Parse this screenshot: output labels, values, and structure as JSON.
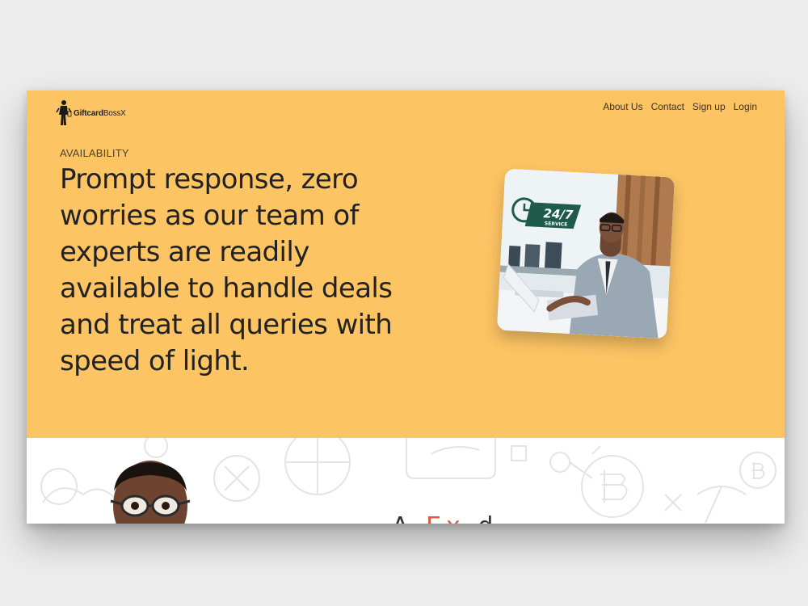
{
  "brand": {
    "name_bold": "Giftcard",
    "name_rest": "BossX"
  },
  "nav": {
    "items": [
      "About Us",
      "Contact",
      "Sign up",
      "Login"
    ]
  },
  "hero": {
    "eyebrow": "AVAILABILITY",
    "headline": "Prompt response, zero worries as our team of experts are readily available to handle deals and treat all queries with speed of light.",
    "badge_text": "24/7",
    "badge_subtext": "SERVICE"
  },
  "lower": {
    "title_start": "A",
    "title_accent": "Ex",
    "title_end": "d"
  },
  "colors": {
    "hero_bg": "#fdc464",
    "text_dark": "#222222",
    "accent": "#e8553e",
    "badge_green": "#1f5b4b"
  }
}
